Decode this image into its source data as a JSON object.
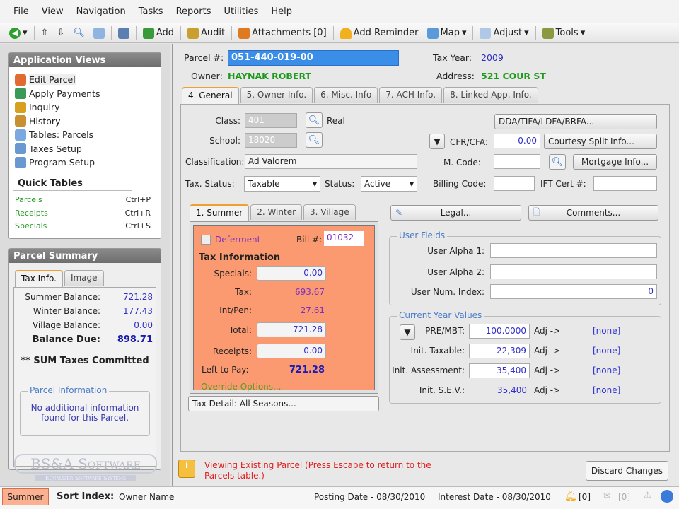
{
  "menu": [
    "File",
    "View",
    "Navigation",
    "Tasks",
    "Reports",
    "Utilities",
    "Help"
  ],
  "toolbar": {
    "add": "Add",
    "audit": "Audit",
    "attachments": "Attachments [0]",
    "add_reminder": "Add Reminder",
    "map": "Map",
    "adjust": "Adjust",
    "tools": "Tools"
  },
  "app_views": {
    "title": "Application Views",
    "items": [
      "Edit Parcel",
      "Apply Payments",
      "Inquiry",
      "History",
      "Tables: Parcels",
      "Taxes Setup",
      "Program Setup"
    ]
  },
  "quick_tables": {
    "title": "Quick Tables",
    "items": [
      {
        "label": "Parcels",
        "shortcut": "Ctrl+P"
      },
      {
        "label": "Receipts",
        "shortcut": "Ctrl+R"
      },
      {
        "label": "Specials",
        "shortcut": "Ctrl+S"
      }
    ]
  },
  "summary": {
    "title": "Parcel Summary",
    "tabs": [
      "Tax Info.",
      "Image"
    ],
    "rows": [
      {
        "label": "Summer Balance:",
        "value": "721.28"
      },
      {
        "label": "Winter Balance:",
        "value": "177.43"
      },
      {
        "label": "Village Balance:",
        "value": "0.00"
      }
    ],
    "due_label": "Balance Due:",
    "due_value": "898.71",
    "committed": "** SUM Taxes Committed",
    "info_title": "Parcel Information",
    "info_text": "No additional information found for this Parcel."
  },
  "logo": {
    "name": "BS&A Software",
    "tagline": "Equalizer Software Systems"
  },
  "header": {
    "parcel_label": "Parcel #:",
    "parcel": "051-440-019-00",
    "tax_year_label": "Tax Year:",
    "tax_year": "2009",
    "owner_label": "Owner:",
    "owner": "HAYNAK ROBERT",
    "address_label": "Address:",
    "address": "521 COUR ST"
  },
  "tabs": [
    "4. General",
    "5. Owner Info.",
    "6. Misc. Info",
    "7. ACH Info.",
    "8. Linked App. Info."
  ],
  "general": {
    "class_label": "Class:",
    "class": "401",
    "class_type": "Real",
    "school_label": "School:",
    "school": "18020",
    "classification_label": "Classification:",
    "classification": "Ad Valorem",
    "tax_status_label": "Tax. Status:",
    "tax_status": "Taxable",
    "status_label": "Status:",
    "status": "Active",
    "dda": "DDA/TIFA/LDFA/BRFA...",
    "cfr_label": "CFR/CFA:",
    "cfr": "0.00",
    "courtesy": "Courtesy Split Info...",
    "mcode_label": "M. Code:",
    "mortgage": "Mortgage Info...",
    "billing_label": "Billing Code:",
    "ift_label": "IFT Cert #:",
    "legal": "Legal...",
    "comments": "Comments..."
  },
  "season_tabs": [
    "1. Summer",
    "2. Winter",
    "3. Village"
  ],
  "summer": {
    "deferment": "Deferment",
    "bill_label": "Bill #:",
    "bill": "01032",
    "tax_info": "Tax Information",
    "specials_label": "Specials:",
    "specials": "0.00",
    "tax_label": "Tax:",
    "tax": "693.67",
    "int_label": "Int/Pen:",
    "int": "27.61",
    "total_label": "Total:",
    "total": "721.28",
    "receipts_label": "Receipts:",
    "receipts": "0.00",
    "left_label": "Left to Pay:",
    "left": "721.28",
    "override": "Override Options...",
    "detail": "Tax Detail: All Seasons..."
  },
  "user_fields": {
    "title": "User Fields",
    "alpha1_label": "User Alpha 1:",
    "alpha2_label": "User Alpha 2:",
    "num_label": "User Num. Index:",
    "num": "0"
  },
  "cyv": {
    "title": "Current Year Values",
    "rows": [
      {
        "label": "PRE/MBT:",
        "value": "100.0000",
        "adj": "Adj ->",
        "link": "[none]"
      },
      {
        "label": "Init. Taxable:",
        "value": "22,309",
        "adj": "Adj ->",
        "link": "[none]"
      },
      {
        "label": "Init. Assessment:",
        "value": "35,400",
        "adj": "Adj ->",
        "link": "[none]"
      },
      {
        "label": "Init. S.E.V.:",
        "value": "35,400",
        "adj": "Adj ->",
        "link": "[none]"
      }
    ]
  },
  "message": "Viewing Existing Parcel (Press Escape to return to the Parcels table.)",
  "discard": "Discard Changes",
  "status": {
    "season": "Summer",
    "sort_label": "Sort Index:",
    "sort": "Owner Name",
    "posting": "Posting Date - 08/30/2010",
    "interest": "Interest Date - 08/30/2010",
    "reminders": "[0]",
    "messages": "[0]"
  }
}
